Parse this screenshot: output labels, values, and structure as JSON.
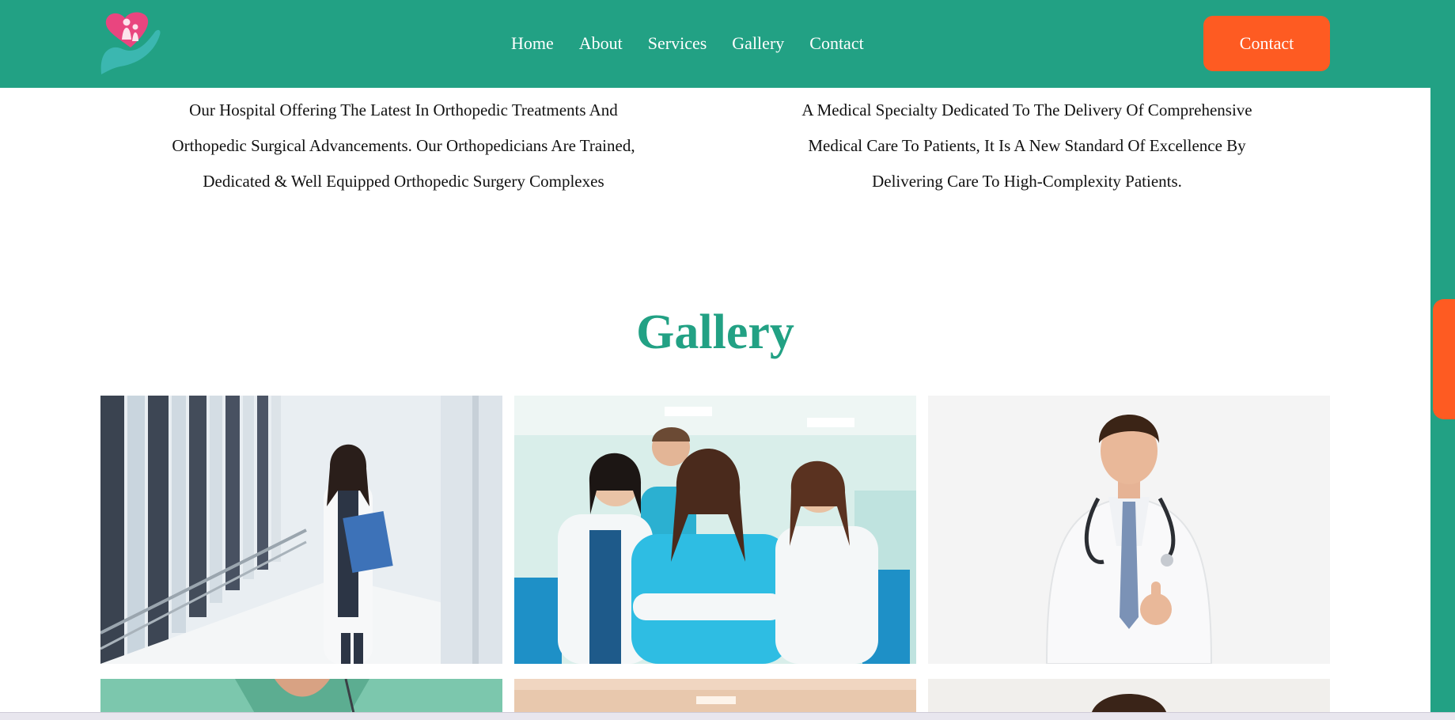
{
  "header": {
    "nav": [
      "Home",
      "About",
      "Services",
      "Gallery",
      "Contact"
    ],
    "cta_label": "Contact"
  },
  "intro": {
    "left_lines": [
      "Our Hospital Offering The Latest In Orthopedic Treatments And",
      "Orthopedic Surgical Advancements. Our Orthopedicians Are Trained,",
      "Dedicated & Well Equipped Orthopedic Surgery Complexes"
    ],
    "right_lines": [
      "A Medical Specialty Dedicated To The Delivery Of Comprehensive",
      "Medical Care To Patients, It Is A New Standard Of Excellence By",
      "Delivering Care To High-Complexity Patients."
    ]
  },
  "gallery": {
    "title": "Gallery"
  },
  "colors": {
    "brand_green": "#22a184",
    "accent_orange": "#fe5b22",
    "logo_pink": "#e9457f",
    "logo_teal": "#3bb7b0"
  },
  "icons": {
    "logo": "heart-hand-logo-icon"
  }
}
